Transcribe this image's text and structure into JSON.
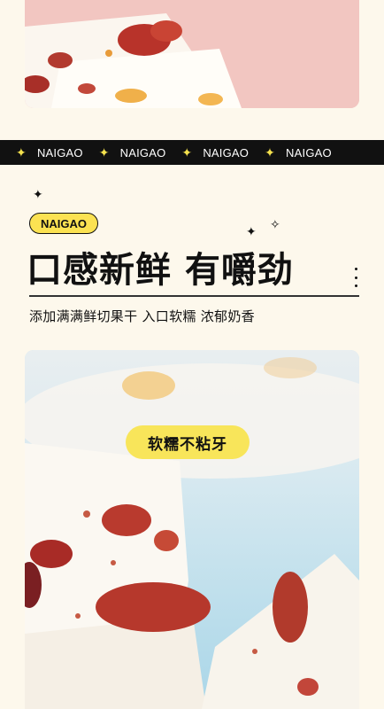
{
  "ticker": {
    "items": [
      "NAIGAO",
      "NAIGAO",
      "NAIGAO",
      "NAIGAO"
    ],
    "star_icon": "sparkle-icon",
    "star_color": "#f5e24e"
  },
  "badge": {
    "label": "NAIGAO",
    "color": "#fbe252"
  },
  "headline": "口感新鲜 有嚼劲",
  "subtitle": "添加满满鲜切果干 入口软糯 浓郁奶香",
  "bubble": {
    "label": "软糯不粘牙",
    "color": "#f8e55a"
  },
  "colors": {
    "background": "#fdf8ec",
    "ticker_bg": "#111111",
    "photo_blue": "#bfe1ee",
    "photo_pink": "#f3c9c4"
  }
}
